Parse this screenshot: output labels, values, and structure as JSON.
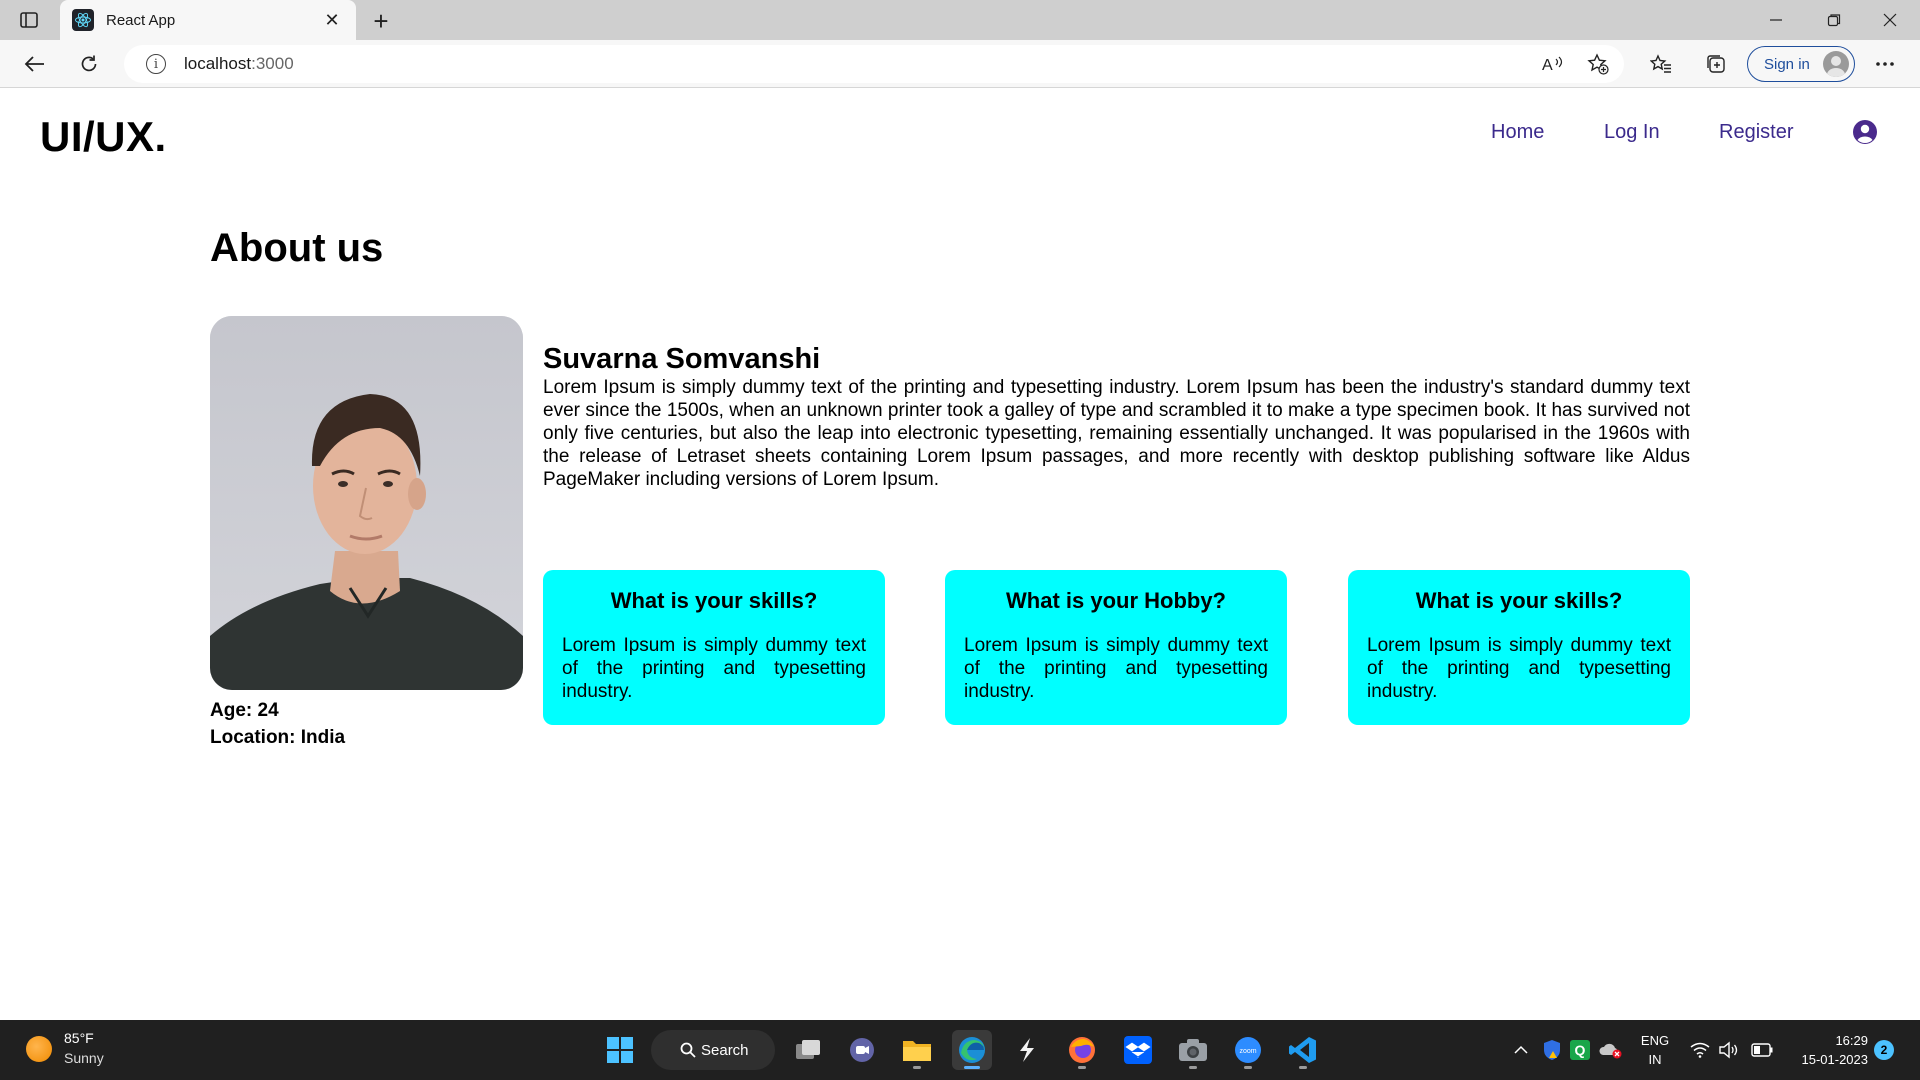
{
  "browser": {
    "tab_title": "React App",
    "url_host": "localhost",
    "url_port": ":3000",
    "signin_label": "Sign in",
    "icons": {
      "tab_actions": "tab-actions-icon",
      "favicon": "react-icon",
      "close": "close-icon",
      "new_tab": "plus-icon",
      "back": "back-arrow-icon",
      "refresh": "refresh-icon",
      "info": "info-icon",
      "read_aloud": "read-aloud-icon",
      "add_favorite": "star-plus-icon",
      "favorites": "favorites-icon",
      "collections": "collections-icon",
      "more": "more-icon"
    }
  },
  "site": {
    "logo": "UI/UX.",
    "nav": [
      "Home",
      "Log In",
      "Register"
    ],
    "user_icon": "user-circle-icon",
    "nav_color": "#3b2a8c"
  },
  "about": {
    "title": "About us",
    "age": "Age: 24",
    "location": "Location: India",
    "name": "Suvarna Somvanshi",
    "bio": "Lorem Ipsum is simply dummy text of the printing and typesetting industry. Lorem Ipsum has been the industry's standard dummy text ever since the 1500s, when an unknown printer took a galley of type and scrambled it to make a type specimen book. It has survived not only five centuries, but also the leap into electronic typesetting, remaining essentially unchanged. It was popularised in the 1960s with the release of Letraset sheets containing Lorem Ipsum passages, and more recently with desktop publishing software like Aldus PageMaker including versions of Lorem Ipsum."
  },
  "cards": [
    {
      "title": "What is your skills?",
      "text": "Lorem Ipsum is simply dummy text of the printing and typesetting industry."
    },
    {
      "title": "What is your Hobby?",
      "text": "Lorem Ipsum is simply dummy text of the printing and typesetting industry."
    },
    {
      "title": "What is your skills?",
      "text": "Lorem Ipsum is simply dummy text of the printing and typesetting industry."
    }
  ],
  "card_color": "#00ffff",
  "taskbar": {
    "temperature": "85°F",
    "condition": "Sunny",
    "search_label": "Search",
    "lang_1": "ENG",
    "lang_2": "IN",
    "time": "16:29",
    "date": "15-01-2023",
    "notification_count": "2"
  }
}
